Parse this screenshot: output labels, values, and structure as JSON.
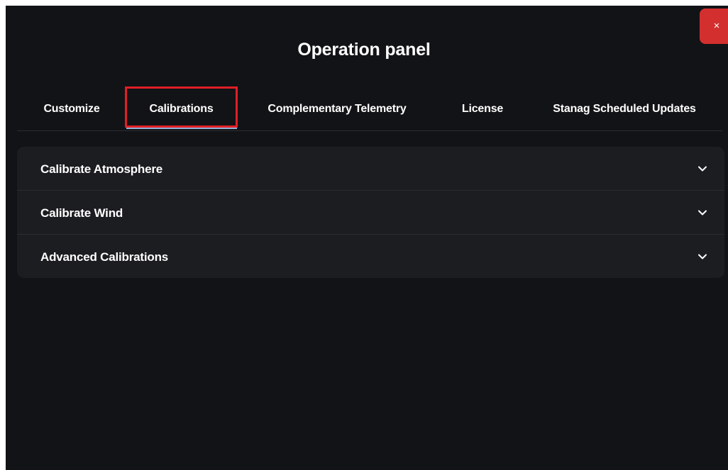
{
  "dialog": {
    "title": "Operation panel",
    "close_label": "×"
  },
  "tabs": [
    {
      "label": "Customize",
      "active": false
    },
    {
      "label": "Calibrations",
      "active": true
    },
    {
      "label": "Complementary Telemetry",
      "active": false
    },
    {
      "label": "License",
      "active": false
    },
    {
      "label": "Stanag Scheduled Updates",
      "active": false
    }
  ],
  "accordion": {
    "items": [
      {
        "label": "Calibrate Atmosphere",
        "icon": "chevron-down-icon"
      },
      {
        "label": "Calibrate Wind",
        "icon": "chevron-down-icon"
      },
      {
        "label": "Advanced Calibrations",
        "icon": "chevron-down-icon"
      }
    ]
  },
  "colors": {
    "panel_bg": "#121316",
    "accordion_bg": "#1c1d21",
    "close_button": "#d32f2f",
    "highlight_box": "#e01f26",
    "active_underline": "#8fb0d6"
  }
}
